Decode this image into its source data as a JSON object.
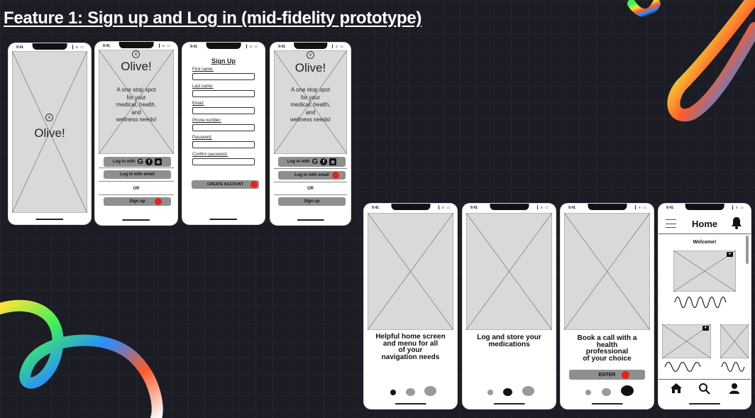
{
  "title": "Feature 1: Sign up and Log in (mid-fidelity prototype)",
  "status_time": "9:41",
  "status_icons": "▎≡ ▭",
  "brand": "Olive!",
  "tagline_lines": [
    "A one stop spot",
    "for your",
    "medical, health,",
    "and",
    "wellness needs!"
  ],
  "login": {
    "with_label": "Log in with",
    "email_label": "Log in with email",
    "or_label": "OR",
    "signup_label": "Sign up"
  },
  "signup": {
    "title": "Sign Up",
    "fields": [
      "First name:",
      "Last name:",
      "Email:",
      "Phone number:",
      "Password:",
      "Confirm password:"
    ],
    "create_label": "CREATE ACCOUNT"
  },
  "onboarding": [
    {
      "text_lines": [
        "Helpful home screen",
        "and menu for all",
        "of your",
        "navigation needs"
      ]
    },
    {
      "text_lines": [
        "Log and store your",
        "medications"
      ]
    },
    {
      "text_lines": [
        "Book a call with a",
        "health",
        "professional",
        "of your choice"
      ],
      "button": "ENTER"
    }
  ],
  "home": {
    "header": "Home",
    "welcome": "Welcome!"
  },
  "icons": {
    "close": "close-icon",
    "google": "google-icon",
    "facebook": "facebook-icon",
    "instagram": "instagram-icon",
    "bell": "bell-icon",
    "menu": "hamburger-icon",
    "home": "home-icon",
    "search": "search-icon",
    "profile": "profile-icon"
  },
  "colors": {
    "background": "#1b1c24",
    "accent_red": "#e5221b",
    "button_gray": "#8f8f8f",
    "placeholder_gray": "#d9d9d9"
  }
}
